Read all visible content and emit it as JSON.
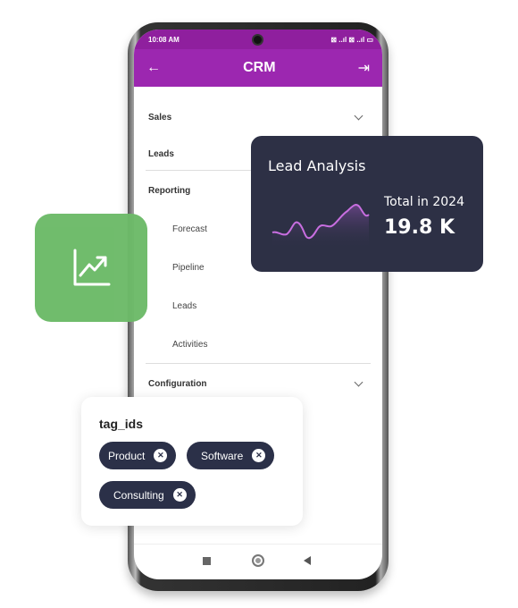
{
  "status_bar": {
    "time": "10:08 AM",
    "indicators": "⊠ ..ıl ⊠ ..ıl ▭"
  },
  "app_bar": {
    "title": "CRM",
    "back_icon": "arrow-left-icon",
    "logout_icon": "logout-icon"
  },
  "menu": {
    "sales": "Sales",
    "leads": "Leads",
    "reporting": "Reporting",
    "reporting_items": [
      "Forecast",
      "Pipeline",
      "Leads",
      "Activities"
    ],
    "configuration": "Configuration"
  },
  "lead_card": {
    "title": "Lead Analysis",
    "label": "Total in 2024",
    "value": "19.8 K"
  },
  "tag_card": {
    "title": "tag_ids",
    "tags": [
      "Product",
      "Software",
      "Consulting"
    ]
  },
  "colors": {
    "header": "#9c27b0",
    "dark_card": "#2d3045",
    "green": "#6cba68",
    "sparkline": "#c86ee0"
  }
}
